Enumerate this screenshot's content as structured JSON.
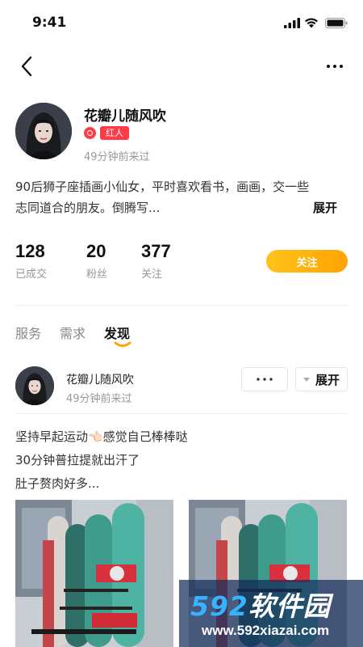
{
  "status_bar": {
    "time": "9:41"
  },
  "profile": {
    "name": "花瓣儿随风吹",
    "badge": "红人",
    "last_seen": "49分钟前来过",
    "bio_line1": "90后狮子座插画小仙女，平时喜欢看书，画画，交一些",
    "bio_line2": "志同道合的朋友。倒腾写...",
    "expand_label": "展开"
  },
  "stats": [
    {
      "value": "128",
      "label": "已成交"
    },
    {
      "value": "20",
      "label": "粉丝"
    },
    {
      "value": "377",
      "label": "关注"
    }
  ],
  "follow_label": "关注",
  "tabs": [
    {
      "label": "服务",
      "active": false
    },
    {
      "label": "需求",
      "active": false
    },
    {
      "label": "发现",
      "active": true
    }
  ],
  "post": {
    "author": "花瓣儿随风吹",
    "time": "49分钟前来过",
    "more_label": "···",
    "expand_label": "展开",
    "lines": [
      "坚持早起运动👈🏻感觉自己棒棒哒",
      "30分钟普拉提就出汗了",
      "肚子赘肉好多..."
    ]
  },
  "watermark": {
    "num": "592",
    "text": "软件园",
    "url": "www.592xiazai.com"
  },
  "colors": {
    "accent": "#ffa300",
    "badge": "#ff3b48",
    "watermark_bg": "#142d5a"
  }
}
